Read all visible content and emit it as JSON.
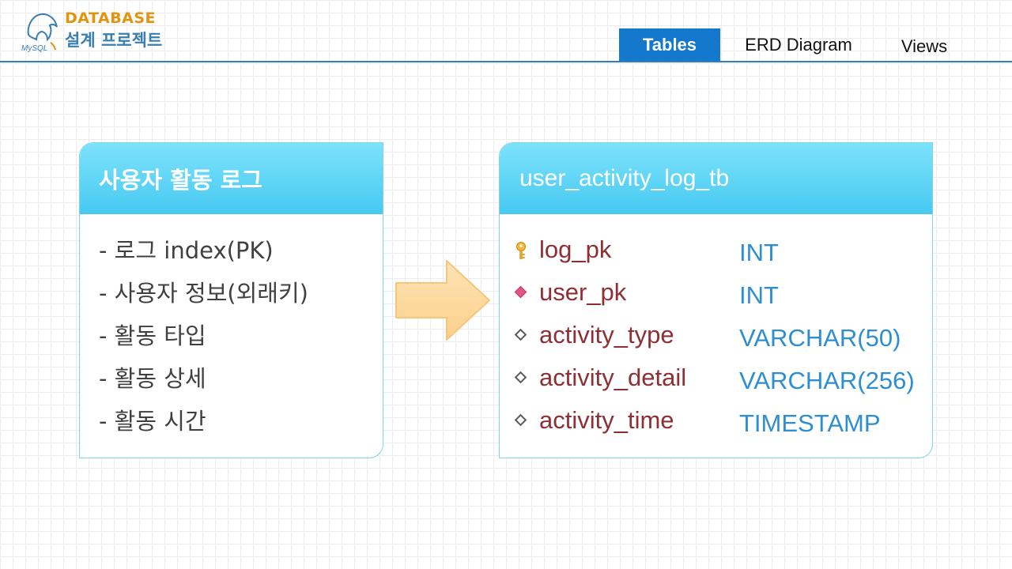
{
  "header": {
    "brand_top": "DATABASE",
    "brand_bottom": "설계 프로젝트",
    "logo_text": "MySQL"
  },
  "nav": {
    "tabs": [
      {
        "label": "Tables",
        "active": true
      },
      {
        "label": "ERD Diagram",
        "active": false
      },
      {
        "label": "Views",
        "active": false
      }
    ]
  },
  "left_card": {
    "title": "사용자 활동 로그",
    "items": [
      "- 로그 index(PK)",
      "- 사용자 정보(외래키)",
      "- 활동 타입",
      "- 활동 상세",
      "- 활동 시간"
    ]
  },
  "right_card": {
    "title": "user_activity_log_tb",
    "columns": [
      {
        "name": "log_pk",
        "type": "INT",
        "icon": "key-icon"
      },
      {
        "name": "user_pk",
        "type": "INT",
        "icon": "foreign-key-diamond-icon"
      },
      {
        "name": "activity_type",
        "type": "VARCHAR(50)",
        "icon": "column-diamond-icon"
      },
      {
        "name": "activity_detail",
        "type": "VARCHAR(256)",
        "icon": "column-diamond-icon"
      },
      {
        "name": "activity_time",
        "type": "TIMESTAMP",
        "icon": "column-diamond-icon"
      }
    ]
  },
  "colors": {
    "accent_blue": "#1478cc",
    "card_header": "#46c9f1",
    "column_name": "#8e2f36",
    "column_type": "#2e8ed1",
    "arrow": "#fdd9a0",
    "brand_orange": "#e0940f"
  },
  "icons": {
    "arrow": "right-arrow-icon",
    "logo": "mysql-dolphin-logo"
  }
}
